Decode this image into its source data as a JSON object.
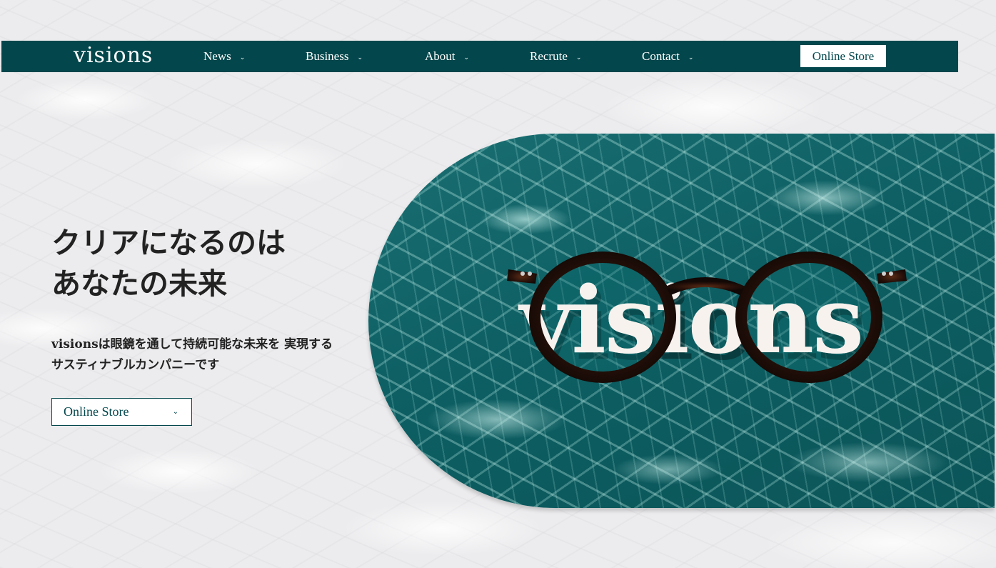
{
  "header": {
    "logo": "visions",
    "nav": [
      {
        "label": "News"
      },
      {
        "label": "Business"
      },
      {
        "label": "About"
      },
      {
        "label": "Recrute"
      },
      {
        "label": "Contact"
      }
    ],
    "store_button": "Online Store"
  },
  "hero": {
    "headline_line1": "クリアになるのは",
    "headline_line2": "あなたの未来",
    "tagline_line1": "visionsは眼鏡を通して持続可能な未来を 実現する",
    "tagline_line2": "サスティナブルカンパニーです",
    "cta_label": "Online Store",
    "image_wordmark": "visions"
  },
  "icons": {
    "dropdown": "chevron-down-icon"
  },
  "colors": {
    "brand": "#03474c",
    "text": "#222222",
    "background": "#ececee",
    "button_bg": "#ffffff"
  }
}
